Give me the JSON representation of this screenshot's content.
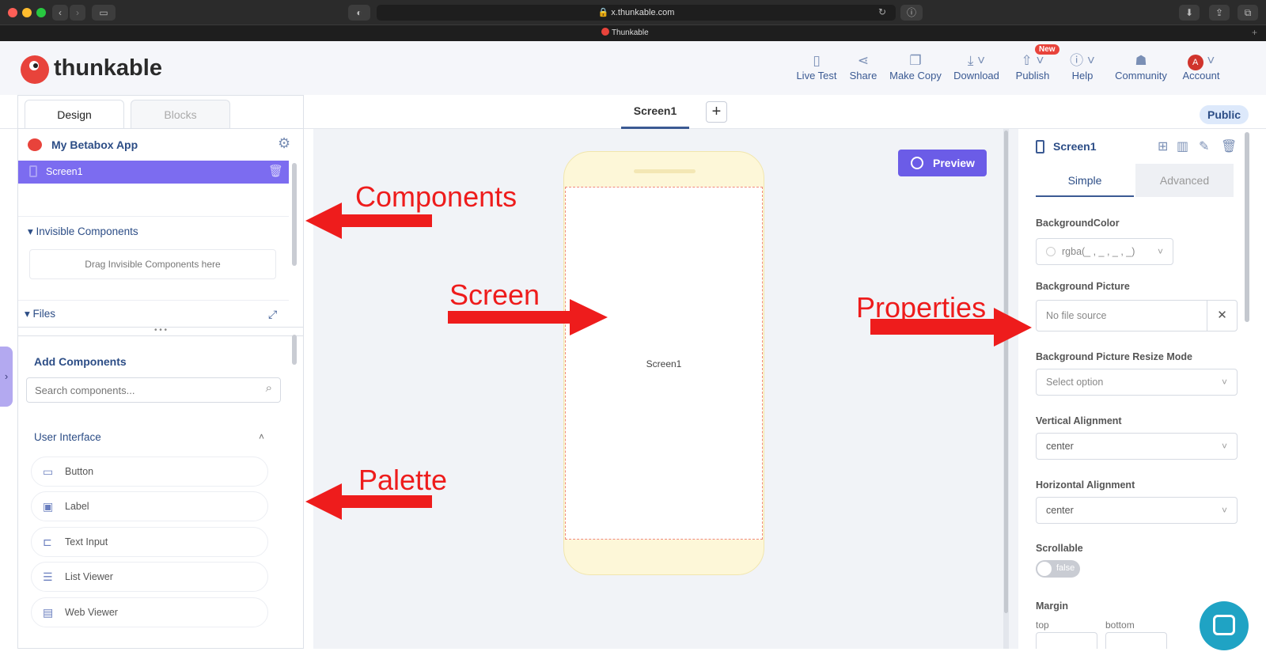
{
  "browser": {
    "url": "x.thunkable.com",
    "tab_title": "Thunkable"
  },
  "app": {
    "logo_text": "thunkable",
    "nav": [
      {
        "label": "Live Test",
        "icon": "phone-icon"
      },
      {
        "label": "Share",
        "icon": "share-icon"
      },
      {
        "label": "Make Copy",
        "icon": "copy-icon"
      },
      {
        "label": "Download",
        "icon": "download-icon"
      },
      {
        "label": "Publish",
        "icon": "publish-icon",
        "badge": "New"
      },
      {
        "label": "Help",
        "icon": "help-icon"
      },
      {
        "label": "Community",
        "icon": "community-icon"
      },
      {
        "label": "Account",
        "icon": "avatar-icon",
        "avatar_letter": "A"
      }
    ]
  },
  "tabs": {
    "design": "Design",
    "blocks": "Blocks"
  },
  "screen_tab": {
    "label": "Screen1",
    "add": "+"
  },
  "public_badge": "Public",
  "left": {
    "project_name": "My Betabox App",
    "screen_item": "Screen1",
    "invisible_header": "Invisible Components",
    "invisible_drop": "Drag Invisible Components here",
    "files_header": "Files",
    "add_components": "Add Components",
    "search_placeholder": "Search components...",
    "ui_header": "User Interface",
    "palette": [
      "Button",
      "Label",
      "Text Input",
      "List Viewer",
      "Web Viewer"
    ]
  },
  "canvas": {
    "preview_label": "Preview",
    "phone_screen_label": "Screen1"
  },
  "right": {
    "title": "Screen1",
    "tab_simple": "Simple",
    "tab_advanced": "Advanced",
    "bg_color_label": "BackgroundColor",
    "bg_color_value": "rgba(_ , _ , _ , _)",
    "bg_picture_label": "Background Picture",
    "bg_picture_value": "No file source",
    "resize_label": "Background Picture Resize Mode",
    "resize_value": "Select option",
    "valign_label": "Vertical Alignment",
    "valign_value": "center",
    "halign_label": "Horizontal Alignment",
    "halign_value": "center",
    "scroll_label": "Scrollable",
    "scroll_value": "false",
    "margin_label": "Margin",
    "margin_top": "top",
    "margin_bottom": "bottom"
  },
  "annotations": {
    "components": "Components",
    "screen": "Screen",
    "properties": "Properties",
    "palette": "Palette"
  },
  "colors": {
    "accent": "#6b5ce7",
    "primary_blue": "#3b5a93",
    "annotation_red": "#ee1c1c"
  }
}
